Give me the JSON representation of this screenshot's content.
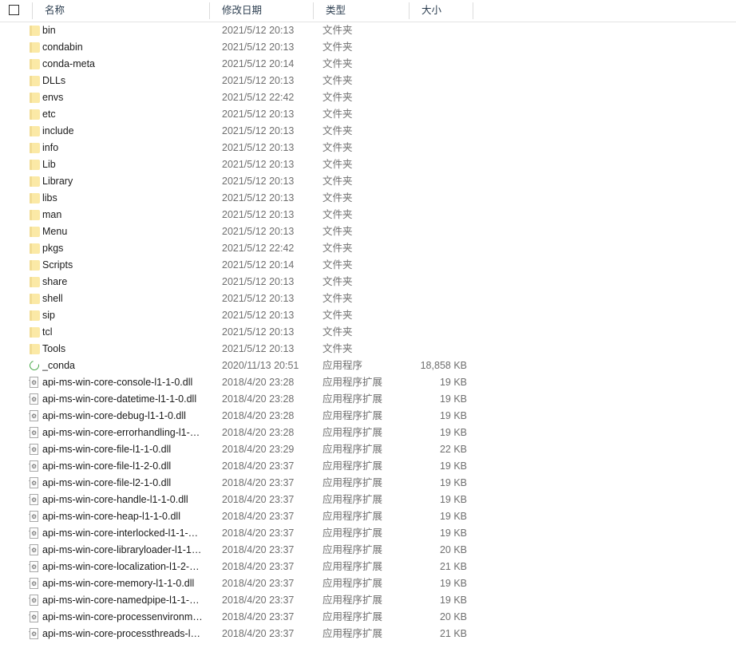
{
  "header": {
    "sort_caret": "⌃",
    "checkbox_checked": false,
    "columns": [
      {
        "key": "name",
        "label": "名称"
      },
      {
        "key": "date",
        "label": "修改日期"
      },
      {
        "key": "type",
        "label": "类型"
      },
      {
        "key": "size",
        "label": "大小"
      }
    ]
  },
  "colors": {
    "folder_icon": "#fbe9a6",
    "folder_tab": "#f2dc94",
    "conda_green": "#4aa84a",
    "header_text": "#2c3e50",
    "name_text": "#1b1b1b",
    "meta_text": "#6f6f6f",
    "divider": "#dcdcdc"
  },
  "types": {
    "folder": "文件夹",
    "application": "应用程序",
    "application_extension": "应用程序扩展"
  },
  "rows": [
    {
      "icon": "folder-icon",
      "name": "bin",
      "date": "2021/5/12 20:13",
      "type": "文件夹",
      "size": ""
    },
    {
      "icon": "folder-icon",
      "name": "condabin",
      "date": "2021/5/12 20:13",
      "type": "文件夹",
      "size": ""
    },
    {
      "icon": "folder-icon",
      "name": "conda-meta",
      "date": "2021/5/12 20:14",
      "type": "文件夹",
      "size": ""
    },
    {
      "icon": "folder-icon",
      "name": "DLLs",
      "date": "2021/5/12 20:13",
      "type": "文件夹",
      "size": ""
    },
    {
      "icon": "folder-icon",
      "name": "envs",
      "date": "2021/5/12 22:42",
      "type": "文件夹",
      "size": ""
    },
    {
      "icon": "folder-icon",
      "name": "etc",
      "date": "2021/5/12 20:13",
      "type": "文件夹",
      "size": ""
    },
    {
      "icon": "folder-icon",
      "name": "include",
      "date": "2021/5/12 20:13",
      "type": "文件夹",
      "size": ""
    },
    {
      "icon": "folder-icon",
      "name": "info",
      "date": "2021/5/12 20:13",
      "type": "文件夹",
      "size": ""
    },
    {
      "icon": "folder-icon",
      "name": "Lib",
      "date": "2021/5/12 20:13",
      "type": "文件夹",
      "size": ""
    },
    {
      "icon": "folder-icon",
      "name": "Library",
      "date": "2021/5/12 20:13",
      "type": "文件夹",
      "size": ""
    },
    {
      "icon": "folder-icon",
      "name": "libs",
      "date": "2021/5/12 20:13",
      "type": "文件夹",
      "size": ""
    },
    {
      "icon": "folder-icon",
      "name": "man",
      "date": "2021/5/12 20:13",
      "type": "文件夹",
      "size": ""
    },
    {
      "icon": "folder-icon",
      "name": "Menu",
      "date": "2021/5/12 20:13",
      "type": "文件夹",
      "size": ""
    },
    {
      "icon": "folder-icon",
      "name": "pkgs",
      "date": "2021/5/12 22:42",
      "type": "文件夹",
      "size": ""
    },
    {
      "icon": "folder-icon",
      "name": "Scripts",
      "date": "2021/5/12 20:14",
      "type": "文件夹",
      "size": ""
    },
    {
      "icon": "folder-icon",
      "name": "share",
      "date": "2021/5/12 20:13",
      "type": "文件夹",
      "size": ""
    },
    {
      "icon": "folder-icon",
      "name": "shell",
      "date": "2021/5/12 20:13",
      "type": "文件夹",
      "size": ""
    },
    {
      "icon": "folder-icon",
      "name": "sip",
      "date": "2021/5/12 20:13",
      "type": "文件夹",
      "size": ""
    },
    {
      "icon": "folder-icon",
      "name": "tcl",
      "date": "2021/5/12 20:13",
      "type": "文件夹",
      "size": ""
    },
    {
      "icon": "folder-icon",
      "name": "Tools",
      "date": "2021/5/12 20:13",
      "type": "文件夹",
      "size": ""
    },
    {
      "icon": "anaconda-icon",
      "name": "_conda",
      "date": "2020/11/13 20:51",
      "type": "应用程序",
      "size": "18,858 KB"
    },
    {
      "icon": "dll-icon",
      "name": "api-ms-win-core-console-l1-1-0.dll",
      "date": "2018/4/20 23:28",
      "type": "应用程序扩展",
      "size": "19 KB"
    },
    {
      "icon": "dll-icon",
      "name": "api-ms-win-core-datetime-l1-1-0.dll",
      "date": "2018/4/20 23:28",
      "type": "应用程序扩展",
      "size": "19 KB"
    },
    {
      "icon": "dll-icon",
      "name": "api-ms-win-core-debug-l1-1-0.dll",
      "date": "2018/4/20 23:28",
      "type": "应用程序扩展",
      "size": "19 KB"
    },
    {
      "icon": "dll-icon",
      "name": "api-ms-win-core-errorhandling-l1-…",
      "date": "2018/4/20 23:28",
      "type": "应用程序扩展",
      "size": "19 KB"
    },
    {
      "icon": "dll-icon",
      "name": "api-ms-win-core-file-l1-1-0.dll",
      "date": "2018/4/20 23:29",
      "type": "应用程序扩展",
      "size": "22 KB"
    },
    {
      "icon": "dll-icon",
      "name": "api-ms-win-core-file-l1-2-0.dll",
      "date": "2018/4/20 23:37",
      "type": "应用程序扩展",
      "size": "19 KB"
    },
    {
      "icon": "dll-icon",
      "name": "api-ms-win-core-file-l2-1-0.dll",
      "date": "2018/4/20 23:37",
      "type": "应用程序扩展",
      "size": "19 KB"
    },
    {
      "icon": "dll-icon",
      "name": "api-ms-win-core-handle-l1-1-0.dll",
      "date": "2018/4/20 23:37",
      "type": "应用程序扩展",
      "size": "19 KB"
    },
    {
      "icon": "dll-icon",
      "name": "api-ms-win-core-heap-l1-1-0.dll",
      "date": "2018/4/20 23:37",
      "type": "应用程序扩展",
      "size": "19 KB"
    },
    {
      "icon": "dll-icon",
      "name": "api-ms-win-core-interlocked-l1-1-…",
      "date": "2018/4/20 23:37",
      "type": "应用程序扩展",
      "size": "19 KB"
    },
    {
      "icon": "dll-icon",
      "name": "api-ms-win-core-libraryloader-l1-1…",
      "date": "2018/4/20 23:37",
      "type": "应用程序扩展",
      "size": "20 KB"
    },
    {
      "icon": "dll-icon",
      "name": "api-ms-win-core-localization-l1-2-…",
      "date": "2018/4/20 23:37",
      "type": "应用程序扩展",
      "size": "21 KB"
    },
    {
      "icon": "dll-icon",
      "name": "api-ms-win-core-memory-l1-1-0.dll",
      "date": "2018/4/20 23:37",
      "type": "应用程序扩展",
      "size": "19 KB"
    },
    {
      "icon": "dll-icon",
      "name": "api-ms-win-core-namedpipe-l1-1-…",
      "date": "2018/4/20 23:37",
      "type": "应用程序扩展",
      "size": "19 KB"
    },
    {
      "icon": "dll-icon",
      "name": "api-ms-win-core-processenvironm…",
      "date": "2018/4/20 23:37",
      "type": "应用程序扩展",
      "size": "20 KB"
    },
    {
      "icon": "dll-icon",
      "name": "api-ms-win-core-processthreads-l…",
      "date": "2018/4/20 23:37",
      "type": "应用程序扩展",
      "size": "21 KB"
    }
  ]
}
